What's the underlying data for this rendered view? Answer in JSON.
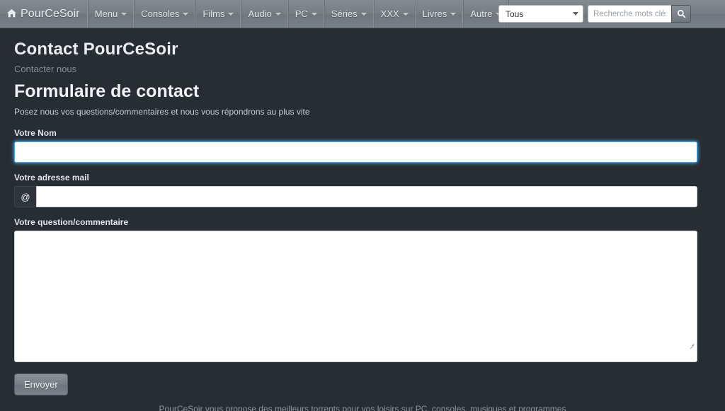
{
  "navbar": {
    "brand": {
      "label": "PourCeSoir",
      "icon": "home-icon"
    },
    "items": [
      {
        "label": "Menu",
        "caret": true
      },
      {
        "label": "Consoles",
        "caret": true
      },
      {
        "label": "Films",
        "caret": true
      },
      {
        "label": "Audio",
        "caret": true
      },
      {
        "label": "PC",
        "caret": true
      },
      {
        "label": "Séries",
        "caret": true
      },
      {
        "label": "XXX",
        "caret": true
      },
      {
        "label": "Livres",
        "caret": true
      },
      {
        "label": "Autre",
        "caret": true
      }
    ],
    "search": {
      "category_value": "Tous",
      "input_value": "",
      "placeholder": "Recherche mots clés",
      "button_icon": "search-icon"
    }
  },
  "page": {
    "title": "Contact PourCeSoir",
    "subtitle": "Contacter nous",
    "form_title": "Formulaire de contact",
    "form_description": "Posez nous vos questions/commentaires et nous vous répondrons au plus vite"
  },
  "form": {
    "name": {
      "label": "Votre Nom",
      "value": "",
      "placeholder": "",
      "focused": true
    },
    "email": {
      "label": "Votre adresse mail",
      "value": "",
      "placeholder": "",
      "addon": "@"
    },
    "message": {
      "label": "Votre question/commentaire",
      "value": "",
      "placeholder": ""
    },
    "submit_label": "Envoyer"
  },
  "footer": {
    "text": "PourCeSoir vous propose des meilleurs torrents pour vos loisirs sur PC, consoles, musiques et programmes"
  },
  "colors": {
    "background": "#282d33",
    "navbar": "#767d84",
    "focus_ring": "#4aa8e8",
    "heading": "#e9edf0",
    "muted": "#868e96"
  }
}
